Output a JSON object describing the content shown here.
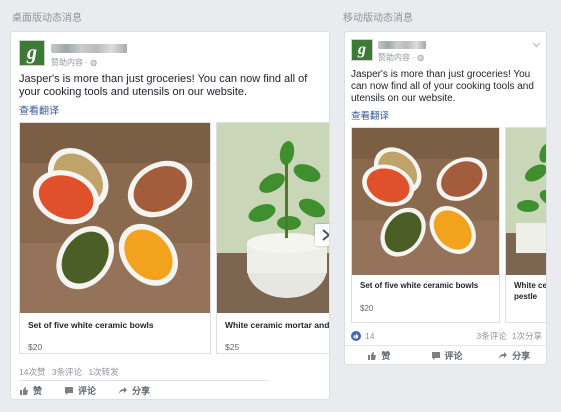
{
  "desktop": {
    "section_label": "桌面版动态消息",
    "sponsored": "赞助内容 · ◍",
    "message": "Jasper's is more than just groceries! You can now find all of your cooking tools and utensils on our website.",
    "translate": "查看翻译",
    "items": [
      {
        "title": "Set of five white ceramic bowls",
        "price": "$20"
      },
      {
        "title": "White ceramic mortar and p",
        "price": "$25"
      }
    ],
    "stats": {
      "likes": "14次赞",
      "comments": "3条评论",
      "shares": "1次转发"
    },
    "actions": {
      "like": "赞",
      "comment": "评论",
      "share": "分享"
    }
  },
  "mobile": {
    "section_label": "移动版动态消息",
    "sponsored": "赞助内容 · ◍",
    "message": "Jasper's is more than just groceries! You can now find all of your cooking tools and utensils on our website.",
    "translate": "查看翻译",
    "items": [
      {
        "title": "Set of five white ceramic bowls",
        "price": "$20"
      },
      {
        "title": "White ce",
        "title2": "pestle",
        "price": ""
      }
    ],
    "stats": {
      "likes": "14",
      "comments": "3条评论",
      "shares": "1次分享"
    },
    "actions": {
      "like": "赞",
      "comment": "评论",
      "share": "分享"
    }
  },
  "colors": {
    "brand": "#3c7a35",
    "link": "#365899",
    "like_blue": "#4267b2"
  }
}
